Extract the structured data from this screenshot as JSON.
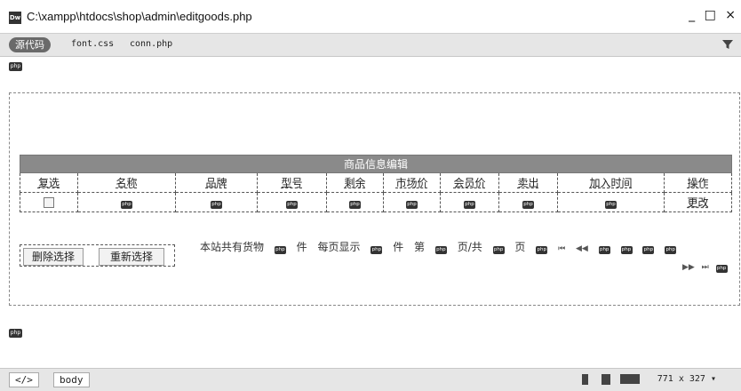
{
  "window": {
    "title": "C:\\xampp\\htdocs\\shop\\admin\\editgoods.php",
    "app_icon_text": "Dw",
    "minimize": "_",
    "maximize": "□",
    "close": "×"
  },
  "doc_toolbar": {
    "source_label": "源代码",
    "related_files": [
      "font.css",
      "conn.php"
    ]
  },
  "php_tag": "php",
  "table": {
    "title": "商品信息编辑",
    "headers": [
      "复选",
      "名称",
      "品牌",
      "型号",
      "剩余",
      "市场价",
      "会员价",
      "卖出",
      "加入时间",
      "操作"
    ],
    "row_action": "更改"
  },
  "buttons": {
    "delete_selected": "删除选择",
    "reselect": "重新选择"
  },
  "pager": {
    "total_prefix": "本站共有货物",
    "unit1": "件",
    "per_page": "每页显示",
    "unit2": "件",
    "page_prefix": "第",
    "page_sep": "页/共",
    "page_suffix": "页",
    "first": "⏮",
    "prev": "◀◀",
    "next": "▶▶",
    "last": "⏭"
  },
  "status_bar": {
    "tag_selector_icon": "</>",
    "tag": "body",
    "viewport_size": "771 x 327",
    "dropdown": "▾"
  }
}
